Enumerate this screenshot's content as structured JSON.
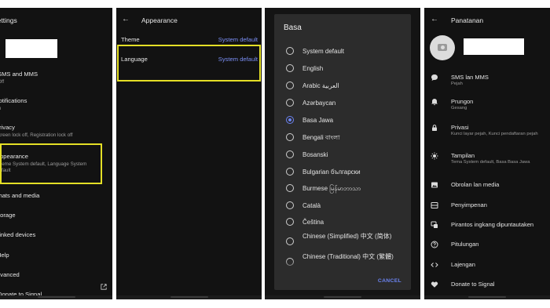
{
  "settings": {
    "title": "Settings",
    "items": [
      {
        "label": "SMS and MMS",
        "sub": "Off"
      },
      {
        "label": "Notifications",
        "sub": "On"
      },
      {
        "label": "Privacy",
        "sub": "Screen lock off, Registration lock off"
      },
      {
        "label": "Appearance",
        "sub": "Theme System default, Language System default"
      },
      {
        "label": "Chats and media",
        "sub": ""
      },
      {
        "label": "Storage",
        "sub": ""
      },
      {
        "label": "Linked devices",
        "sub": ""
      },
      {
        "label": "Help",
        "sub": ""
      },
      {
        "label": "Advanced",
        "sub": ""
      },
      {
        "label": "Donate to Signal",
        "sub": ""
      }
    ]
  },
  "appearance": {
    "title": "Appearance",
    "theme_label": "Theme",
    "theme_value": "System default",
    "language_label": "Language",
    "language_value": "System default"
  },
  "language_dialog": {
    "title": "Basa",
    "selected_index": 4,
    "options": [
      "System default",
      "English",
      "Arabic العربية",
      "Azərbaycan",
      "Basa Jawa",
      "Bengali বাংলা",
      "Bosanski",
      "Bulgarian български",
      "Burmese မြန်မာဘာသာ",
      "Català",
      "Čeština",
      "Chinese (Simplified) 中文 (简体)",
      "Chinese (Traditional) 中文 (繁體)"
    ],
    "cancel_label": "CANCEL"
  },
  "panatanan": {
    "title": "Panatanan",
    "items": [
      {
        "label": "SMS lan MMS",
        "sub": "Pejah",
        "icon": "chat-bubble-icon"
      },
      {
        "label": "Prungon",
        "sub": "Gesang",
        "icon": "bell-icon"
      },
      {
        "label": "Privasi",
        "sub": "Kunci layar pejah, Kunci pendaftaran pejah",
        "icon": "lock-icon"
      },
      {
        "label": "Tampilan",
        "sub": "Tema System default, Basa Basa Jawa",
        "icon": "brightness-icon"
      },
      {
        "label": "Obrolan lan media",
        "sub": "",
        "icon": "image-icon"
      },
      {
        "label": "Penyimpenan",
        "sub": "",
        "icon": "storage-icon"
      },
      {
        "label": "Pirantos ingkang dipuntautaken",
        "sub": "",
        "icon": "linked-devices-icon"
      },
      {
        "label": "Pitulungan",
        "sub": "",
        "icon": "help-icon"
      },
      {
        "label": "Lajengan",
        "sub": "",
        "icon": "code-icon"
      },
      {
        "label": "Donate to Signal",
        "sub": "",
        "icon": "heart-icon"
      }
    ]
  },
  "colors": {
    "highlight": "#e4df26",
    "accent": "#6b83f0",
    "background": "#121212"
  }
}
